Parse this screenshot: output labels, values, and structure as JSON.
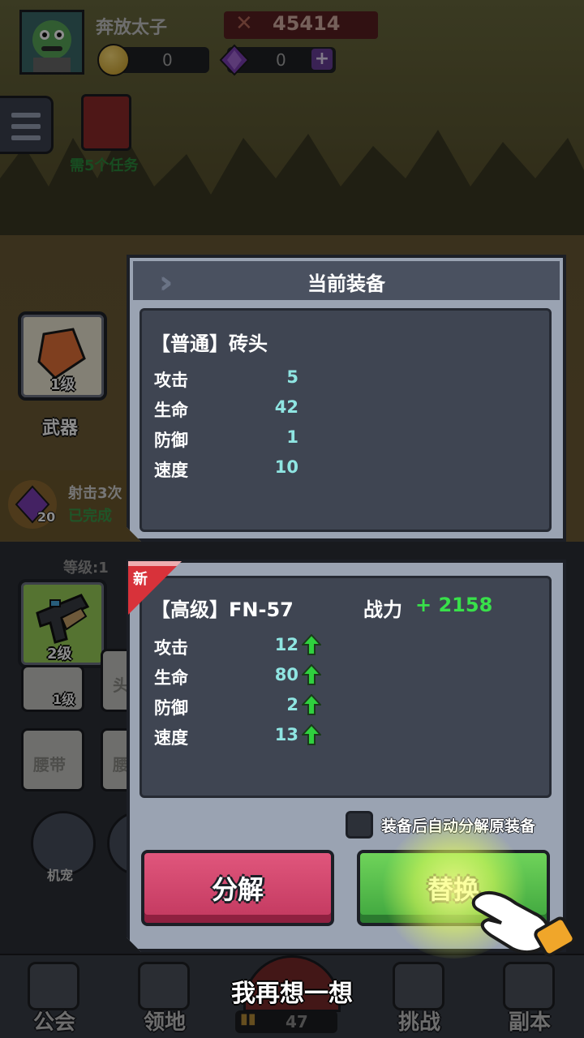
{
  "hud": {
    "player_name": "奔放太子",
    "combat_power": "45414",
    "coins": "0",
    "gems": "0",
    "plus_label": "+",
    "task_requirement": "需5个任务"
  },
  "left_panel": {
    "weapon_level": "1级",
    "weapon_label": "武器",
    "quest_text": "射击3次",
    "quest_status": "已完成",
    "quest_reward": "20",
    "level_label": "等级:1",
    "gun_level": "2级",
    "brick_level": "1级",
    "slot_helmet": "头",
    "slot_belt": "腰带",
    "slot_belt2": "腰",
    "pet_label": "机宠"
  },
  "current_equipment": {
    "title": "当前装备",
    "name": "【普通】砖头",
    "stats": [
      {
        "label": "攻击",
        "value": "5"
      },
      {
        "label": "生命",
        "value": "42"
      },
      {
        "label": "防御",
        "value": "1"
      },
      {
        "label": "速度",
        "value": "10"
      }
    ]
  },
  "new_equipment": {
    "new_badge": "新",
    "name": "【高级】FN-57",
    "power_label": "战力",
    "power_gain": "+ 2158",
    "stats": [
      {
        "label": "攻击",
        "value": "12"
      },
      {
        "label": "生命",
        "value": "80"
      },
      {
        "label": "防御",
        "value": "2"
      },
      {
        "label": "速度",
        "value": "13"
      }
    ],
    "auto_decompose_label": "装备后自动分解原装备",
    "auto_decompose_checked": false,
    "decompose_button": "分解",
    "replace_button": "替换"
  },
  "think_again": "我再想一想",
  "bottom_nav": {
    "guild": "公会",
    "territory": "领地",
    "ammo": "47",
    "challenge": "挑战",
    "dungeon": "副本"
  },
  "colors": {
    "stat_value": "#8fe5e2",
    "power_gain": "#38e04a",
    "decompose": "#d24a70",
    "replace": "#4fbb48",
    "panel_frame": "#9aa3b2"
  }
}
